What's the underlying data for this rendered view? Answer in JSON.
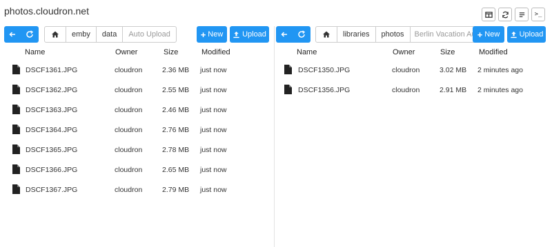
{
  "app": {
    "title": "photos.cloudron.net"
  },
  "top_actions": [
    {
      "name": "view-toggle-icon"
    },
    {
      "name": "sync-icon"
    },
    {
      "name": "list-icon"
    },
    {
      "name": "terminal-icon",
      "label": ">_"
    }
  ],
  "columns": {
    "name": "Name",
    "owner": "Owner",
    "size": "Size",
    "modified": "Modified"
  },
  "left": {
    "breadcrumb": [
      "emby",
      "data",
      "Auto Upload"
    ],
    "new_label": "New",
    "upload_label": "Upload",
    "files": [
      {
        "name": "DSCF1361.JPG",
        "owner": "cloudron",
        "size": "2.36 MB",
        "modified": "just now"
      },
      {
        "name": "DSCF1362.JPG",
        "owner": "cloudron",
        "size": "2.55 MB",
        "modified": "just now"
      },
      {
        "name": "DSCF1363.JPG",
        "owner": "cloudron",
        "size": "2.46 MB",
        "modified": "just now"
      },
      {
        "name": "DSCF1364.JPG",
        "owner": "cloudron",
        "size": "2.76 MB",
        "modified": "just now"
      },
      {
        "name": "DSCF1365.JPG",
        "owner": "cloudron",
        "size": "2.78 MB",
        "modified": "just now"
      },
      {
        "name": "DSCF1366.JPG",
        "owner": "cloudron",
        "size": "2.65 MB",
        "modified": "just now"
      },
      {
        "name": "DSCF1367.JPG",
        "owner": "cloudron",
        "size": "2.79 MB",
        "modified": "just now"
      }
    ]
  },
  "right": {
    "breadcrumb": [
      "libraries",
      "photos",
      "Berlin Vacation Aug"
    ],
    "new_label": "New",
    "upload_label": "Upload",
    "files": [
      {
        "name": "DSCF1350.JPG",
        "owner": "cloudron",
        "size": "3.02 MB",
        "modified": "2 minutes ago"
      },
      {
        "name": "DSCF1356.JPG",
        "owner": "cloudron",
        "size": "2.91 MB",
        "modified": "2 minutes ago"
      }
    ]
  },
  "colors": {
    "accent": "#2196f3"
  }
}
